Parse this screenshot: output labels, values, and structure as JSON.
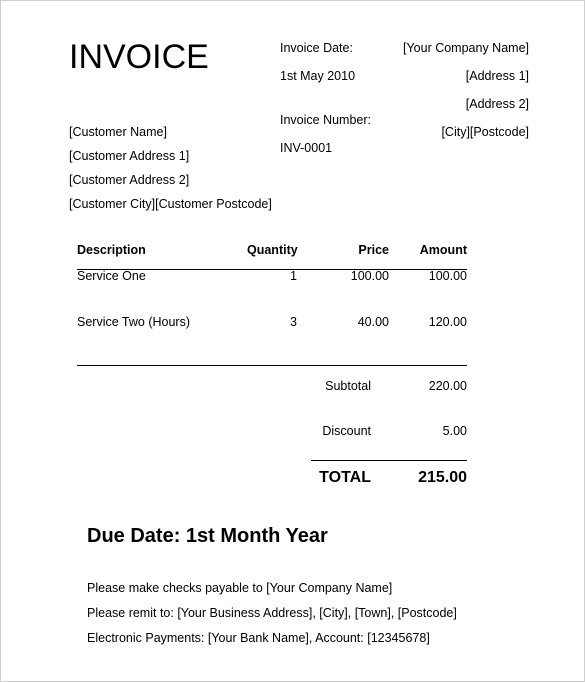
{
  "document": {
    "title": "INVOICE"
  },
  "meta": {
    "invoice_date_label": "Invoice Date:",
    "invoice_date_value": "1st May 2010",
    "invoice_number_label": "Invoice Number:",
    "invoice_number_value": "INV-0001"
  },
  "company": {
    "lines": [
      "[Your Company Name]",
      "[Address 1]",
      "[Address 2]",
      "[City][Postcode]"
    ]
  },
  "customer": {
    "lines": [
      "[Customer Name]",
      "[Customer Address  1]",
      "[Customer Address 2]",
      "[Customer City][Customer Postcode]"
    ]
  },
  "table": {
    "columns": [
      "Description",
      "Quantity",
      "Price",
      "Amount"
    ],
    "rows": [
      {
        "description": "Service One",
        "quantity": "1",
        "price": "100.00",
        "amount": "100.00"
      },
      {
        "description": "Service Two (Hours)",
        "quantity": "3",
        "price": "40.00",
        "amount": "120.00"
      }
    ]
  },
  "totals": {
    "subtotal_label": "Subtotal",
    "subtotal_value": "220.00",
    "discount_label": "Discount",
    "discount_value": "5.00",
    "total_label": "TOTAL",
    "total_value": "215.00"
  },
  "footer": {
    "due_date": "Due Date: 1st Month Year",
    "notes": [
      "Please make checks payable to [Your Company Name]",
      "Please remit to: [Your Business Address], [City], [Town], [Postcode]",
      "Electronic Payments: [Your Bank Name], Account: [12345678]"
    ]
  }
}
